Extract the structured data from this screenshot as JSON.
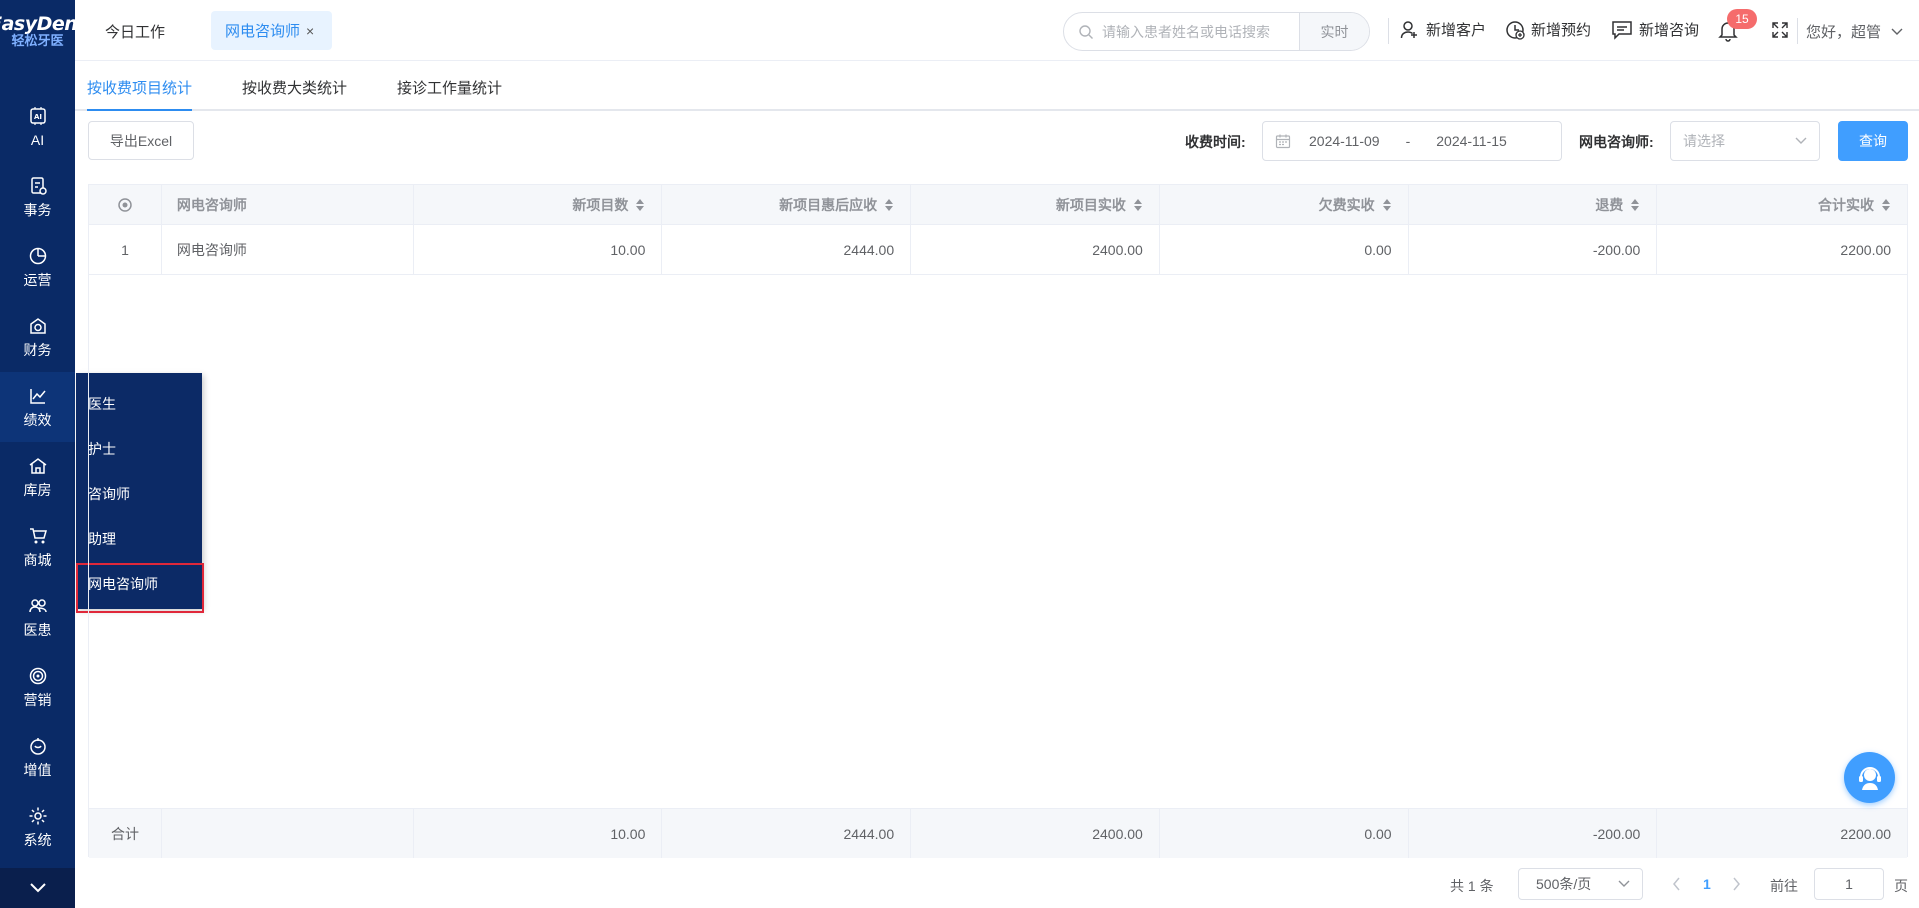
{
  "brand": {
    "logo_en": "EasyDent",
    "logo_cn": "轻松牙医"
  },
  "sidebar": {
    "items": [
      {
        "label": "AI",
        "icon": "ai-icon"
      },
      {
        "label": "事务",
        "icon": "affairs-icon"
      },
      {
        "label": "运营",
        "icon": "operations-icon"
      },
      {
        "label": "财务",
        "icon": "finance-icon"
      },
      {
        "label": "绩效",
        "icon": "performance-icon"
      },
      {
        "label": "库房",
        "icon": "warehouse-icon"
      },
      {
        "label": "商城",
        "icon": "mall-icon"
      },
      {
        "label": "医患",
        "icon": "doctor-patient-icon"
      },
      {
        "label": "营销",
        "icon": "marketing-icon"
      },
      {
        "label": "增值",
        "icon": "value-added-icon"
      },
      {
        "label": "系统",
        "icon": "system-icon"
      }
    ],
    "active": "绩效"
  },
  "flyout": {
    "items": [
      "医生",
      "护士",
      "咨询师",
      "助理",
      "网电咨询师"
    ],
    "highlighted": "网电咨询师"
  },
  "topbar": {
    "tab_today": "今日工作",
    "tab_active": "网电咨询师",
    "search_placeholder": "请输入患者姓名或电话搜索",
    "search_mode": "实时",
    "new_customer": "新增客户",
    "new_appointment": "新增预约",
    "new_consult": "新增咨询",
    "notification_count": "15",
    "greeting": "您好，超管"
  },
  "subtabs": [
    "按收费项目统计",
    "按收费大类统计",
    "接诊工作量统计"
  ],
  "toolbar": {
    "export": "导出Excel",
    "time_label": "收费时间:",
    "date_start": "2024-11-09",
    "date_sep": "-",
    "date_end": "2024-11-15",
    "consult_label": "网电咨询师:",
    "consult_placeholder": "请选择",
    "query": "查询"
  },
  "table": {
    "headers": [
      "网电咨询师",
      "新项目数",
      "新项目惠后应收",
      "新项目实收",
      "欠费实收",
      "退费",
      "合计实收"
    ],
    "rows": [
      {
        "idx": "1",
        "name": "网电咨询师",
        "new_count": "10.00",
        "discount_due": "2444.00",
        "new_paid": "2400.00",
        "arrears_paid": "0.00",
        "refund": "-200.00",
        "total_paid": "2200.00"
      }
    ],
    "footer": {
      "label": "合计",
      "name": "",
      "new_count": "10.00",
      "discount_due": "2444.00",
      "new_paid": "2400.00",
      "arrears_paid": "0.00",
      "refund": "-200.00",
      "total_paid": "2200.00"
    }
  },
  "pagination": {
    "total": "共 1 条",
    "page_size": "500条/页",
    "current": "1",
    "goto_label": "前往",
    "goto_value": "1",
    "page_unit": "页"
  },
  "colors": {
    "sidebar": "#0a2a66",
    "accent": "#409eff",
    "badge": "#f56c6c",
    "highlight_border": "#e0283a"
  }
}
